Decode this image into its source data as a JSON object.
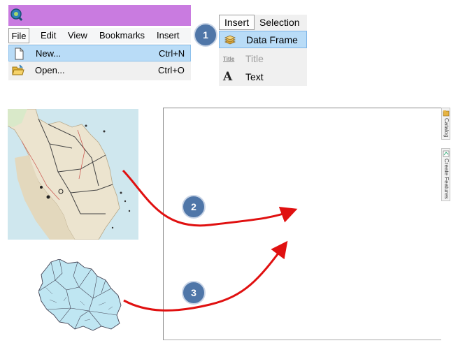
{
  "file_menu": {
    "menubar": [
      "File",
      "Edit",
      "View",
      "Bookmarks",
      "Insert"
    ],
    "items": [
      {
        "label": "New...",
        "shortcut": "Ctrl+N",
        "icon": "new-document-icon"
      },
      {
        "label": "Open...",
        "shortcut": "Ctrl+O",
        "icon": "open-folder-icon"
      }
    ]
  },
  "insert_menu": {
    "tabs": [
      "Insert",
      "Selection"
    ],
    "items": [
      {
        "label": "Data Frame",
        "icon": "data-frame-icon",
        "selected": true
      },
      {
        "label": "Title",
        "icon": "title-icon",
        "icon_text": "Title",
        "disabled": true
      },
      {
        "label": "Text",
        "icon": "text-icon",
        "icon_text": "A"
      }
    ]
  },
  "steps": [
    "1",
    "2",
    "3"
  ],
  "side_panel": {
    "tabs": [
      "Catalog",
      "Create Features"
    ]
  },
  "colors": {
    "titlebar": "#c97be0",
    "badge": "#4f76a8",
    "selection": "#b9dcf7",
    "arrow": "#e01010",
    "district_fill": "#bfe6f2"
  }
}
